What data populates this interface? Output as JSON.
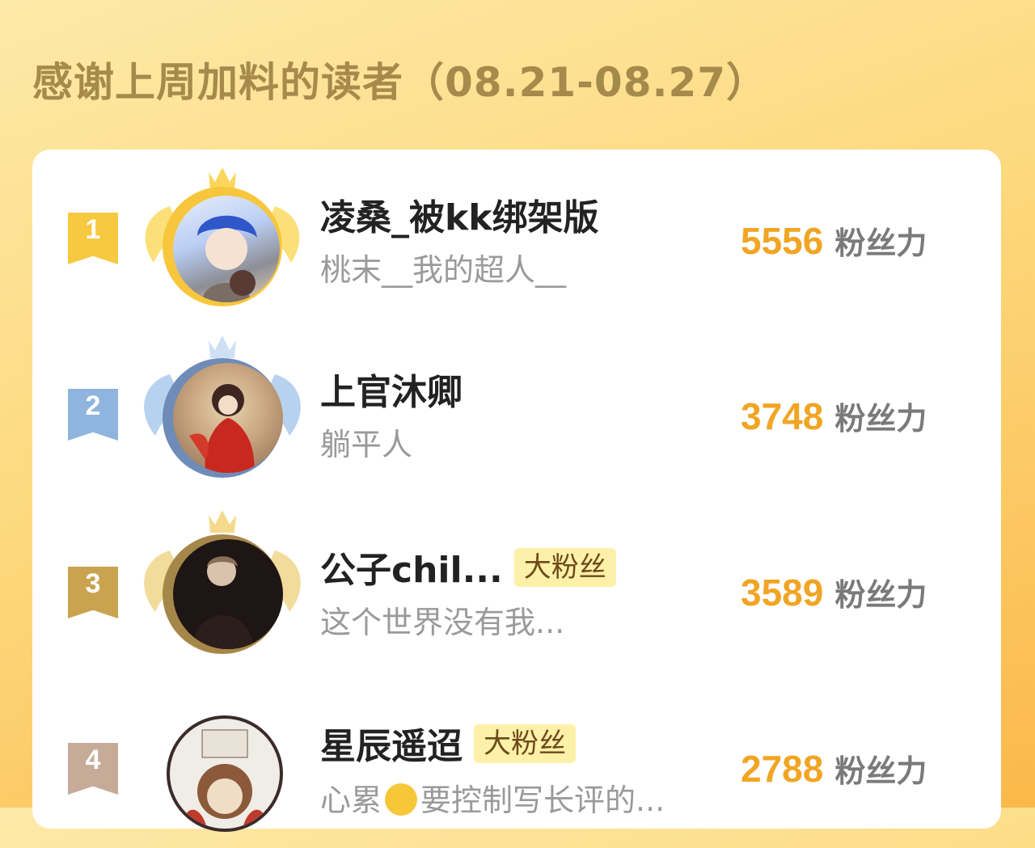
{
  "page_title": "感谢上周加料的读者（08.21-08.27）",
  "readers": [
    {
      "rank": "1",
      "name": "凌桑_被kk绑架版",
      "subtitle": "桃末__我的超人__",
      "score": "5556",
      "unit": "粉丝力",
      "badge": "",
      "rank_color": "#f6c940",
      "frame_color": "#f7c63c",
      "wing_color": "#fbe07a"
    },
    {
      "rank": "2",
      "name": "上官沐卿",
      "subtitle": "躺平人",
      "score": "3748",
      "unit": "粉丝力",
      "badge": "",
      "rank_color": "#8fb5de",
      "frame_color": "#6f8cb8",
      "wing_color": "#b7d2ef"
    },
    {
      "rank": "3",
      "name": "公子chil...",
      "subtitle": "这个世界没有我...",
      "score": "3589",
      "unit": "粉丝力",
      "badge": "大粉丝",
      "rank_color": "#c9a34f",
      "frame_color": "#a6874a",
      "wing_color": "#f2dc9c"
    },
    {
      "rank": "4",
      "name": "星辰遥迢",
      "subtitle_before": "心累",
      "subtitle_emoji": "sweat-smile-emoji",
      "subtitle_after": "要控制写长评的...",
      "score": "2788",
      "unit": "粉丝力",
      "badge": "大粉丝",
      "rank_color": "#c7ab99",
      "frame_color": "#3b2a2a",
      "wing_color": ""
    }
  ]
}
